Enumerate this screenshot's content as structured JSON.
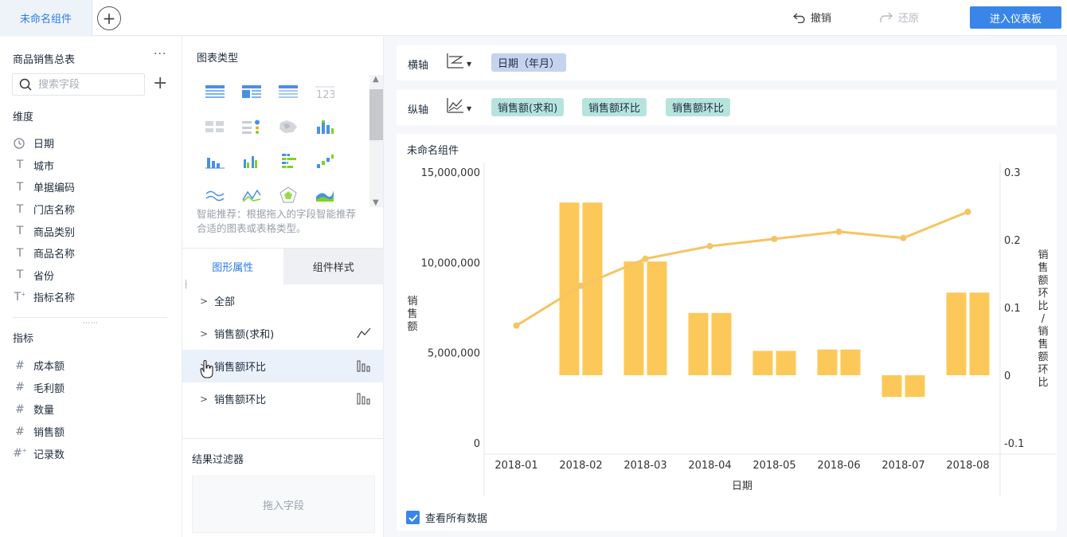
{
  "topbar": {
    "active_tab": "未命名组件",
    "undo_label": "撤销",
    "redo_label": "还原",
    "enter_dashboard_label": "进入仪表板"
  },
  "left_panel": {
    "table_name": "商品销售总表",
    "more_label": "···",
    "search_placeholder": "搜索字段",
    "dimensions_label": "维度",
    "dimensions": [
      {
        "label": "日期",
        "icon": "clock-icon"
      },
      {
        "label": "城市",
        "icon": "text-type-icon"
      },
      {
        "label": "单据编码",
        "icon": "text-type-icon"
      },
      {
        "label": "门店名称",
        "icon": "text-type-icon"
      },
      {
        "label": "商品类别",
        "icon": "text-type-icon"
      },
      {
        "label": "商品名称",
        "icon": "text-type-icon"
      },
      {
        "label": "省份",
        "icon": "text-type-icon"
      },
      {
        "label": "指标名称",
        "icon": "text-type-icon"
      }
    ],
    "measures_label": "指标",
    "measures": [
      {
        "label": "成本额",
        "icon": "number-icon"
      },
      {
        "label": "毛利额",
        "icon": "number-icon"
      },
      {
        "label": "数量",
        "icon": "number-icon"
      },
      {
        "label": "销售额",
        "icon": "number-icon"
      },
      {
        "label": "记录数",
        "icon": "number-icon"
      }
    ]
  },
  "middle_panel": {
    "chart_types_title": "图表类型",
    "hint": "智能推荐：根据拖入的字段智能推荐合适的图表或表格类型。",
    "tabs": [
      "图形属性",
      "组件样式"
    ],
    "properties": [
      {
        "label": "全部",
        "icon": ""
      },
      {
        "label": "销售额(求和)",
        "icon": "line-chart-icon"
      },
      {
        "label": "销售额环比",
        "icon": "bar-chart-icon"
      },
      {
        "label": "销售额环比",
        "icon": "bar-chart-icon"
      }
    ],
    "filter_title": "结果过滤器",
    "filter_placeholder": "拖入字段"
  },
  "axes": {
    "x_label": "横轴",
    "y_label": "纵轴",
    "x_fields": [
      "日期（年月）"
    ],
    "y_fields": [
      "销售额(求和)",
      "销售额环比",
      "销售额环比"
    ]
  },
  "chart_title": "未命名组件",
  "show_all_label": "查看所有数据",
  "colors": {
    "accent": "#3a86e8",
    "bar": "#fcc85a",
    "line": "#f6c463"
  },
  "chart_data": {
    "type": "bar",
    "categories": [
      "2018-01",
      "2018-02",
      "2018-03",
      "2018-04",
      "2018-05",
      "2018-06",
      "2018-07",
      "2018-08"
    ],
    "xlabel": "日期",
    "ylabel_left": "销售额",
    "ylabel_right": "销售额环比/销售额环比",
    "ylim_left": [
      0,
      15000000
    ],
    "yticks_left": [
      "15,000,000",
      "10,000,000",
      "5,000,000",
      "0"
    ],
    "ylim_right": [
      -0.1,
      0.3
    ],
    "yticks_right": [
      "0.3",
      "0.2",
      "0.1",
      "0",
      "-0.1"
    ],
    "series": [
      {
        "name": "销售额(求和)",
        "type": "line",
        "values": [
          6500000,
          8700000,
          10200000,
          10900000,
          11300000,
          11700000,
          11350000,
          12800000
        ]
      },
      {
        "name": "销售额环比",
        "type": "bar",
        "axis": "right",
        "values": [
          0,
          0.255,
          0.168,
          0.092,
          0.036,
          0.038,
          -0.032,
          0.122
        ]
      },
      {
        "name": "销售额环比",
        "type": "bar",
        "axis": "right",
        "values": [
          0,
          0.255,
          0.168,
          0.092,
          0.036,
          0.038,
          -0.032,
          0.122
        ]
      }
    ]
  }
}
